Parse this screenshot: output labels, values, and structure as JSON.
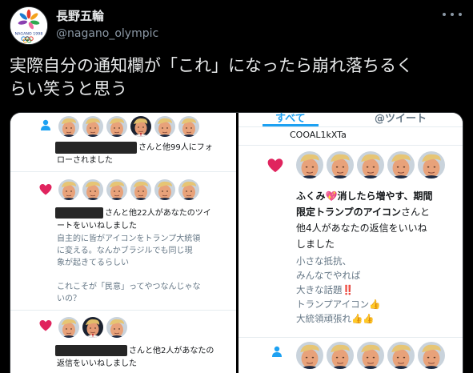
{
  "account": {
    "display_name": "長野五輪",
    "handle": "@nagano_olympic",
    "logo_text": "NAGANO 1998"
  },
  "tweet": {
    "line1": "実際自分の通知欄が「これ」になったら崩れ落ちるく",
    "line2": "らい笑うと思う"
  },
  "left_panel": {
    "n1_text_a": "さんと他99人にフォ",
    "n1_text_b": "ローされました",
    "n2_text_a": "さんと他22人があなたのツイ",
    "n2_text_b": "ートをいいねしました",
    "n2_quote": [
      "自主的に皆がアイコンをトランプ大統領",
      "に変える。なんかブラジルでも同じ現",
      "象が起きてるらしい",
      "",
      "これこそが「民意」ってやつなんじゃな",
      "いの？"
    ],
    "n3_text_a": "さんと他2人があなたの",
    "n3_text_b": "返信をいいねしました"
  },
  "right_panel": {
    "tab_all": "すべて",
    "tab_tweets": "@ツイート",
    "top_text": "COOAL1kXTa",
    "n_text_a1": "ふくみ",
    "n_text_a2": "消したら増やす、期間",
    "n_text_b1": "限定トランプのアイコン",
    "n_text_b2": "さんと",
    "n_text_c": "他4人があなたの返信をいいね",
    "n_text_d": "しました",
    "quote": [
      "小さな抵抗、",
      "みんなでやれば",
      "大きな話題‼️",
      "トランプアイコン👍",
      "大統領頑張れ👍👍"
    ]
  },
  "colors": {
    "background": "#000000",
    "like_heart": "#e0245e",
    "follow_icon": "#1da1f2",
    "text_primary": "#e7e9ea",
    "text_secondary": "#8b98a5"
  },
  "icons": [
    "more-icon",
    "heart-icon",
    "person-icon",
    "trump-face-icon",
    "nagano-logo-icon"
  ]
}
